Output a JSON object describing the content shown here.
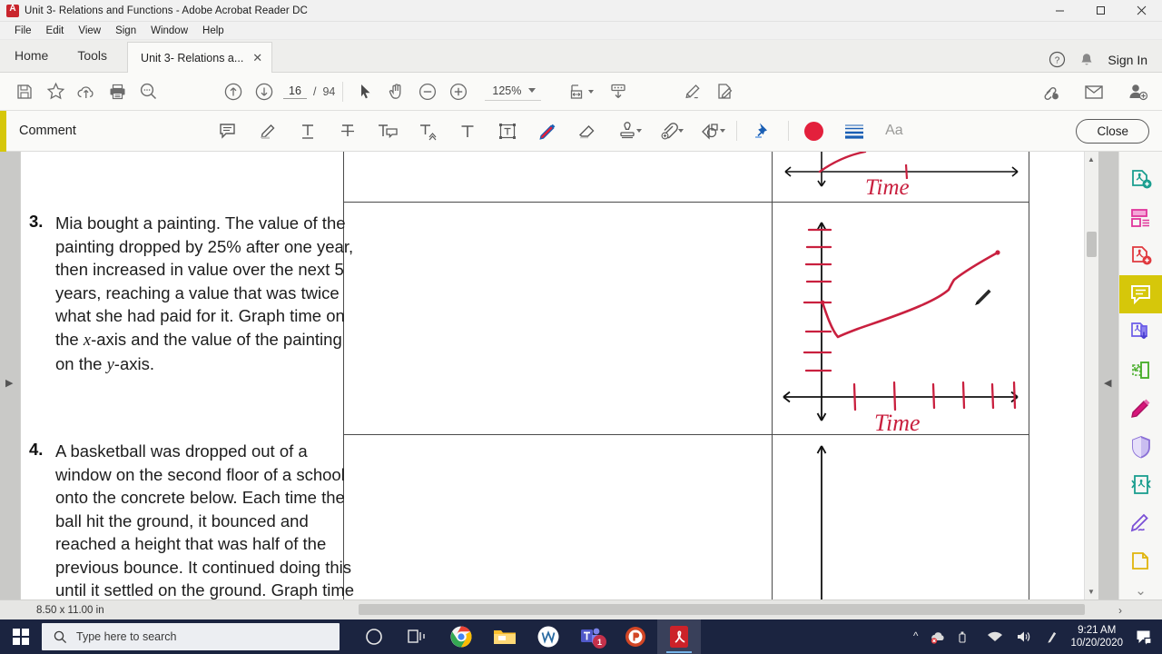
{
  "window": {
    "title": "Unit 3- Relations and Functions - Adobe Acrobat Reader DC",
    "minimize": "—",
    "maximize": "▢",
    "close": "✕"
  },
  "menubar": [
    "File",
    "Edit",
    "View",
    "Sign",
    "Window",
    "Help"
  ],
  "tabstrip": {
    "home": "Home",
    "tools": "Tools",
    "doc_tab": "Unit 3- Relations a...",
    "doc_tab_close": "✕",
    "help_icon": "help-circle-icon",
    "bell_icon": "notification-bell-icon",
    "sign_in": "Sign In"
  },
  "toolbar": {
    "icons_left": [
      "save-icon",
      "star-icon",
      "cloud-upload-icon",
      "print-icon",
      "search-icon"
    ],
    "page_up_icon": "page-up-icon",
    "page_down_icon": "page-down-icon",
    "page_current": "16",
    "page_separator": "/",
    "page_total": "94",
    "select_icon": "cursor-select-icon",
    "hand_icon": "hand-pan-icon",
    "zoom_out_icon": "zoom-out-icon",
    "zoom_in_icon": "zoom-in-icon",
    "zoom_value": "125%",
    "fit_page_icon": "fit-page-icon",
    "scroll_mode_icon": "scroll-mode-icon",
    "sign_icon": "fill-and-sign-icon",
    "edit_pdf_icon": "edit-pdf-icon",
    "share_link_icon": "share-link-icon",
    "email_icon": "email-icon",
    "add_person_icon": "add-person-icon"
  },
  "comment_toolbar": {
    "title": "Comment",
    "tools": [
      "sticky-note-icon",
      "highlighter-icon",
      "underline-text-icon",
      "strikethrough-text-icon",
      "replace-text-icon",
      "insert-text-icon",
      "add-text-icon",
      "text-box-icon",
      "draw-pencil-icon",
      "eraser-icon",
      "stamp-icon",
      "attach-file-icon",
      "shapes-icon"
    ],
    "pin_icon": "pushpin-icon",
    "color_swatch": "#e3203c",
    "thickness_icon": "line-thickness-icon",
    "text_props": "Aa",
    "close_label": "Close",
    "accent_color": "#d6c70a"
  },
  "document": {
    "questions": [
      {
        "number": "3.",
        "lines": [
          "Mia bought a painting.  The value of the",
          "painting dropped by 25% after one year,",
          "then increased in value over the next 5",
          "years, reaching a value that was twice",
          "what she had paid for it.  Graph time on",
          "the x-axis and the value of the painting",
          "on the y-axis."
        ],
        "graph_label": "Time"
      },
      {
        "number": "4.",
        "lines": [
          "A basketball was dropped out of a",
          "window on the second floor of a school",
          "onto the concrete below.  Each time the",
          "ball hit the ground, it bounced and",
          "reached a height that was half of the",
          "previous bounce. It continued doing this",
          "until it settled on the ground. Graph time"
        ]
      }
    ],
    "top_graph_label": "Time",
    "ink_color": "#c9203f",
    "pencil_cursor": "pencil-cursor-icon"
  },
  "right_rail": [
    {
      "name": "create-pdf-icon",
      "color": "#1a9e8f"
    },
    {
      "name": "organize-pages-icon",
      "color": "#e0359b"
    },
    {
      "name": "export-pdf-icon",
      "color": "#e0393e"
    },
    {
      "name": "comment-icon",
      "color": "#ffffff",
      "active": true
    },
    {
      "name": "combine-files-icon",
      "color": "#6b5ce7"
    },
    {
      "name": "crop-pages-icon",
      "color": "#4caf2f"
    },
    {
      "name": "edit-pdf-pen-icon",
      "color": "#d6157a"
    },
    {
      "name": "protect-shield-icon",
      "color": "#8a6fd6"
    },
    {
      "name": "compress-pdf-icon",
      "color": "#1a9e8f"
    },
    {
      "name": "fill-sign-icon",
      "color": "#7a4fd6"
    },
    {
      "name": "stamp-page-icon",
      "color": "#e0b40a"
    }
  ],
  "rail_more_caret": "⌄",
  "statusbar": {
    "page_size": "8.50 x 11.00 in",
    "left_arrow": "‹",
    "right_arrow": "›"
  },
  "taskbar": {
    "start_icon": "windows-start-icon",
    "search_placeholder": "Type here to search",
    "search_icon": "search-icon",
    "cortana_icon": "cortana-circle-icon",
    "taskview_icon": "task-view-icon",
    "apps": [
      {
        "name": "chrome-icon"
      },
      {
        "name": "file-explorer-icon"
      },
      {
        "name": "w-app-icon"
      },
      {
        "name": "microsoft-teams-icon",
        "badge": "1"
      },
      {
        "name": "powerpoint-icon"
      },
      {
        "name": "acrobat-reader-icon",
        "active": true
      }
    ],
    "tray_caret": "^",
    "tray_icons": [
      "onedrive-sync-icon",
      "battery-icon",
      "network-icon",
      "volume-icon",
      "pen-icon"
    ],
    "time": "9:21 AM",
    "date": "10/20/2020",
    "action_center_icon": "action-center-icon"
  }
}
